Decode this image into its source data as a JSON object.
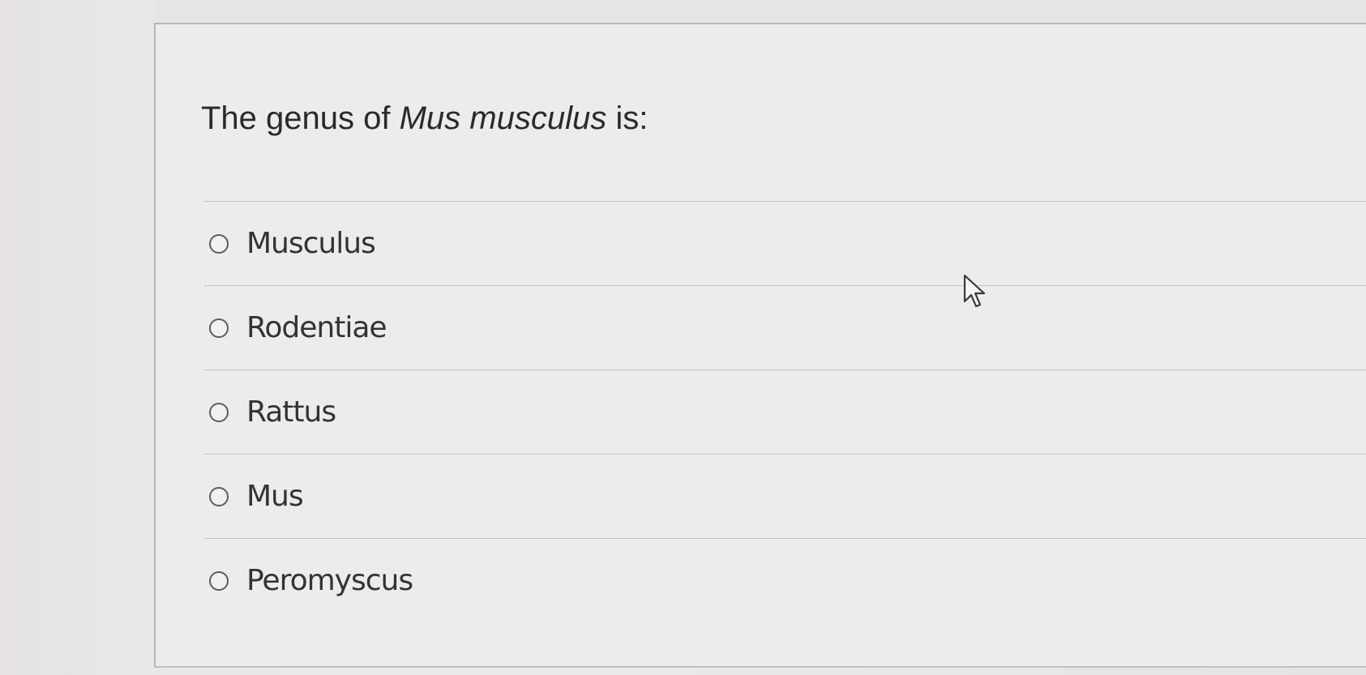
{
  "question": {
    "prefix": "The genus of ",
    "italic": "Mus musculus",
    "suffix": " is:"
  },
  "choices": [
    {
      "label": "Musculus",
      "selected": false
    },
    {
      "label": "Rodentiae",
      "selected": false
    },
    {
      "label": "Rattus",
      "selected": false
    },
    {
      "label": "Mus",
      "selected": false
    },
    {
      "label": "Peromyscus",
      "selected": false
    }
  ],
  "icons": {
    "radio": "radio-unselected-icon",
    "cursor": "mouse-pointer-icon"
  }
}
